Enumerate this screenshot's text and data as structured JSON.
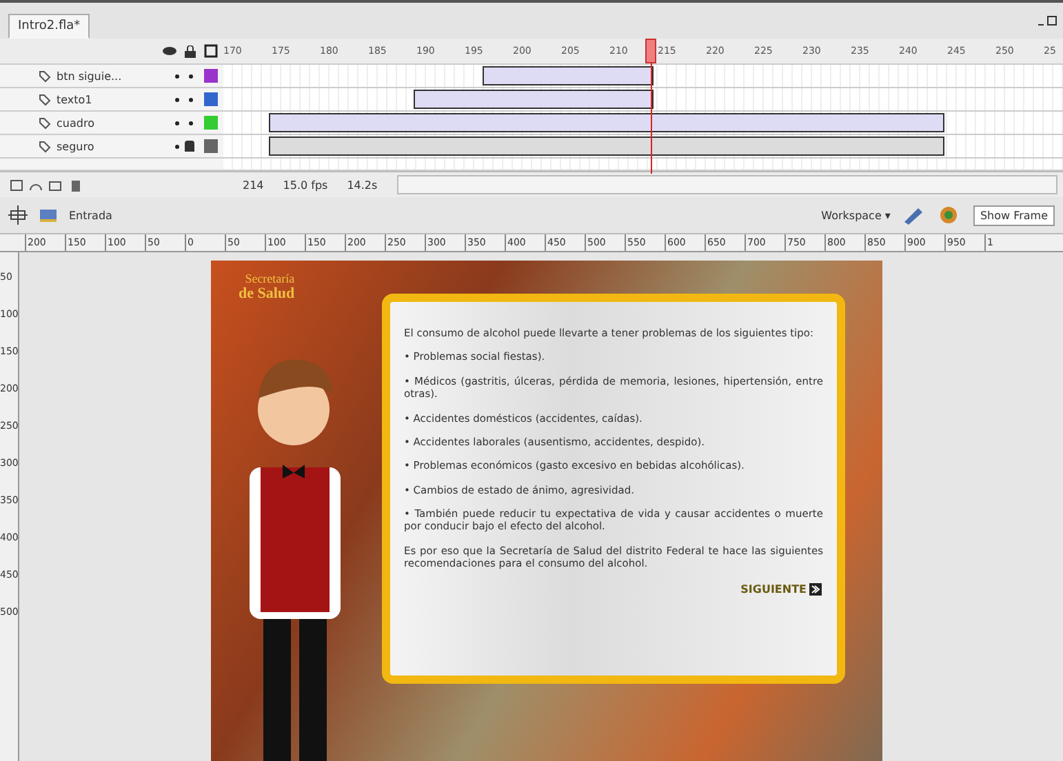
{
  "document_tab": {
    "label": "Intro2.fla*",
    "selected": true
  },
  "timeline": {
    "ruler": [
      "170",
      "175",
      "180",
      "185",
      "190",
      "195",
      "200",
      "205",
      "210",
      "215",
      "220",
      "225",
      "230",
      "235",
      "240",
      "245",
      "250",
      "25"
    ],
    "layers": [
      {
        "name": "btn siguie...",
        "locked": false,
        "color": "#9933cc"
      },
      {
        "name": "texto1",
        "locked": false,
        "color": "#3366cc"
      },
      {
        "name": "cuadro",
        "locked": false,
        "color": "#33cc33"
      },
      {
        "name": "seguro",
        "locked": true,
        "color": "#666666"
      }
    ],
    "current_frame": "214",
    "frame_rate": "15.0 fps",
    "elapsed": "14.2s"
  },
  "edit_bar": {
    "scene": "Entrada",
    "workspace": "Workspace ▾",
    "zoom": "Show Frame"
  },
  "rulers": {
    "horizontal": [
      "200",
      "150",
      "100",
      "50",
      "0",
      "50",
      "100",
      "150",
      "200",
      "250",
      "300",
      "350",
      "400",
      "450",
      "500",
      "550",
      "600",
      "650",
      "700",
      "750",
      "800",
      "850",
      "900",
      "950",
      "1"
    ],
    "vertical": [
      "50",
      "100",
      "150",
      "200",
      "250",
      "300",
      "350",
      "400",
      "450",
      "500"
    ]
  },
  "scene": {
    "logo_line1": "Secretaría",
    "logo_line2": "de Salud",
    "intro": "El consumo de alcohol puede llevarte a tener problemas de los siguientes tipo:",
    "items": [
      "• Problemas social fiestas).",
      "• Médicos (gastritis, úlceras, pérdida de memoria, lesiones, hipertensión, entre otras).",
      "• Accidentes domésticos (accidentes, caídas).",
      "• Accidentes laborales (ausentismo, accidentes, despido).",
      "• Problemas económicos (gasto excesivo en bebidas alcohólicas).",
      "• Cambios de estado de ánimo, agresividad.",
      "• También puede reducir tu expectativa de vida y causar accidentes o muerte por conducir bajo el efecto del alcohol."
    ],
    "closing": "Es por eso que la Secretaría de Salud del distrito Federal te hace las siguientes recomendaciones para el consumo del alcohol.",
    "next_button": "SIGUIENTE"
  }
}
